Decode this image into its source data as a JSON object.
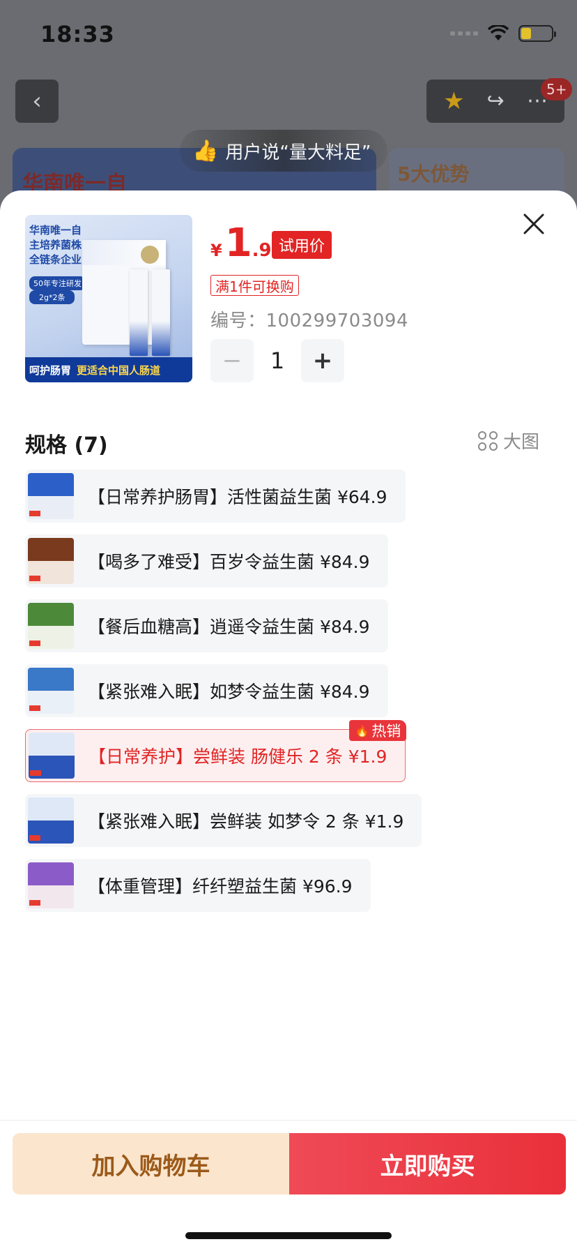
{
  "status_bar": {
    "time": "18:33"
  },
  "header": {
    "notification_badge": "5+"
  },
  "background": {
    "user_says": "用户说“量大料足”",
    "card_left_text": "华南唯一自",
    "card_right_text": "5大优势"
  },
  "product": {
    "image_text": {
      "line1": "华南唯一自",
      "line2": "主培养菌株",
      "line3": "全链条企业",
      "pill": "50年专注研发",
      "pill2": "2g*2条",
      "banner_white": "呵护肠胃",
      "banner_yellow": "更适合中国人肠道"
    },
    "price_symbol": "¥",
    "price_int": "1",
    "price_dec": ".9",
    "price_tag": "试用价",
    "promo": "满1件可换购",
    "sku_code": "编号：100299703094",
    "quantity": "1",
    "minus": "−",
    "plus": "+"
  },
  "specs": {
    "title": "规格 (7)",
    "big_image_label": "大图",
    "hot_label": "热销",
    "items": [
      {
        "label": "【日常养护肠胃】活性菌益生菌  ¥64.9",
        "active": false,
        "thumb_top": "#2c5fc8",
        "thumb_bot": "#e9eef6"
      },
      {
        "label": "【喝多了难受】百岁令益生菌  ¥84.9",
        "active": false,
        "thumb_top": "#7a3a1e",
        "thumb_bot": "#f1e4da"
      },
      {
        "label": "【餐后血糖高】逍遥令益生菌  ¥84.9",
        "active": false,
        "thumb_top": "#4c8a3a",
        "thumb_bot": "#eef2e6"
      },
      {
        "label": "【紧张难入眠】如梦令益生菌  ¥84.9",
        "active": false,
        "thumb_top": "#3a78c8",
        "thumb_bot": "#eaf0f8"
      },
      {
        "label": "【日常养护】尝鲜装 肠健乐 2 条  ¥1.9",
        "active": true,
        "thumb_top": "#dfe8f7",
        "thumb_bot": "#2b55b8"
      },
      {
        "label": "【紧张难入眠】尝鲜装 如梦令 2 条  ¥1.9",
        "active": false,
        "thumb_top": "#dfe8f7",
        "thumb_bot": "#2b55b8"
      },
      {
        "label": "【体重管理】纤纤塑益生菌  ¥96.9",
        "active": false,
        "thumb_top": "#8b5cc8",
        "thumb_bot": "#f3e7ee"
      }
    ]
  },
  "actions": {
    "add_to_cart": "加入购物车",
    "buy_now": "立即购买"
  },
  "colors": {
    "accent_red": "#e22424",
    "cart_bg": "#fbe5cd",
    "cart_text": "#9b5a1a"
  }
}
